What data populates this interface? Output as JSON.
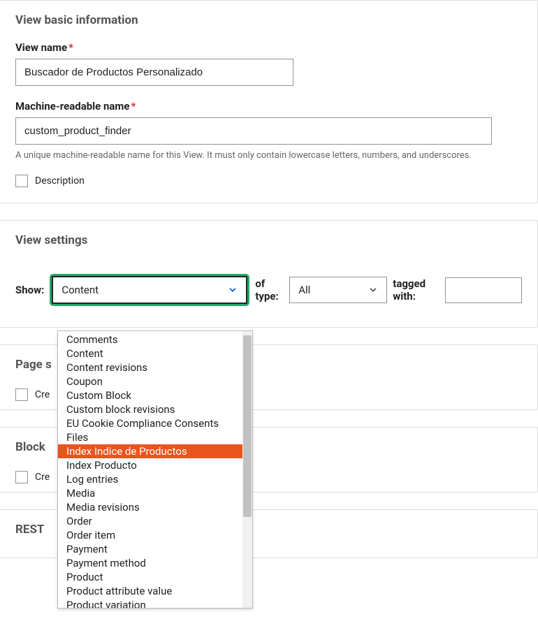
{
  "sections": {
    "basic": {
      "title": "View basic information",
      "view_name_label": "View name",
      "view_name_value": "Buscador de Productos Personalizado",
      "machine_name_label": "Machine-readable name",
      "machine_name_value": "custom_product_finder",
      "machine_name_help": "A unique machine-readable name for this View. It must only contain lowercase letters, numbers, and underscores.",
      "description_label": "Description"
    },
    "view_settings": {
      "title": "View settings",
      "show_label": "Show:",
      "show_value": "Content",
      "of_type_label": "of type:",
      "of_type_value": "All",
      "tagged_with_label": "tagged with:",
      "tagged_with_value": ""
    },
    "page": {
      "title": "Page settings",
      "title_visible": "Page s",
      "create_label": "Create a page",
      "create_label_visible": "Cre"
    },
    "block": {
      "title": "Block settings",
      "title_visible": "Block",
      "create_label": "Create a block",
      "create_label_visible": "Cre"
    },
    "rest": {
      "title": "REST export settings",
      "title_visible": "REST"
    }
  },
  "dropdown": {
    "items": [
      "Comments",
      "Content",
      "Content revisions",
      "Coupon",
      "Custom Block",
      "Custom block revisions",
      "EU Cookie Compliance Consents",
      "Files",
      "Index Indice de Productos",
      "Index Producto",
      "Log entries",
      "Media",
      "Media revisions",
      "Order",
      "Order item",
      "Payment",
      "Payment method",
      "Product",
      "Product attribute value",
      "Product variation"
    ],
    "highlighted_index": 8
  }
}
